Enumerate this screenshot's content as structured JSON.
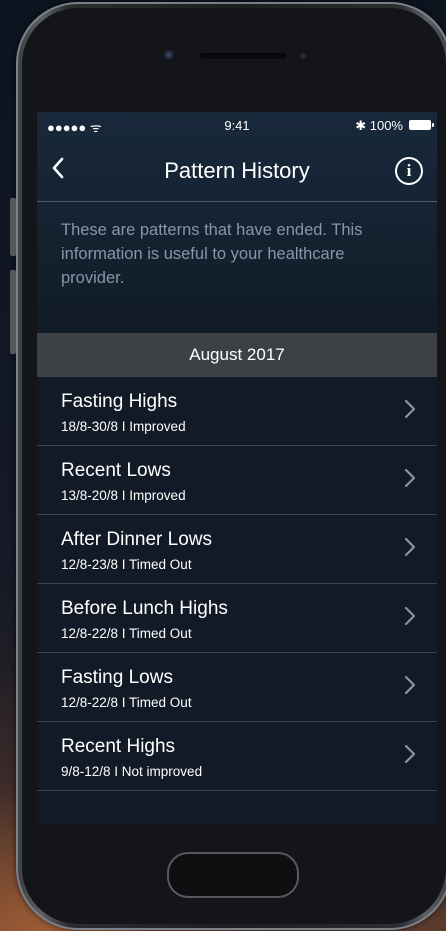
{
  "status_bar": {
    "signal": "●●●●● ᯤ",
    "time": "9:41",
    "battery": "✱ 100%"
  },
  "nav": {
    "back_glyph": "‹",
    "title": "Pattern History",
    "info_glyph": "i"
  },
  "intro_text": "These are patterns that have ended. This information is useful to your healthcare provider.",
  "month": "August 2017",
  "patterns": [
    {
      "title": "Fasting Highs",
      "subtitle": "18/8-30/8  I  Improved"
    },
    {
      "title": "Recent Lows",
      "subtitle": "13/8-20/8  I  Improved"
    },
    {
      "title": "After Dinner Lows",
      "subtitle": "12/8-23/8  I  Timed Out"
    },
    {
      "title": "Before Lunch Highs",
      "subtitle": "12/8-22/8  I  Timed Out"
    },
    {
      "title": "Fasting Lows",
      "subtitle": "12/8-22/8  I Timed Out"
    },
    {
      "title": "Recent Highs",
      "subtitle": "9/8-12/8  I  Not improved"
    }
  ],
  "icons": {
    "back": "chevron-left-icon",
    "info": "info-circle-icon",
    "row": "chevron-right-icon"
  }
}
